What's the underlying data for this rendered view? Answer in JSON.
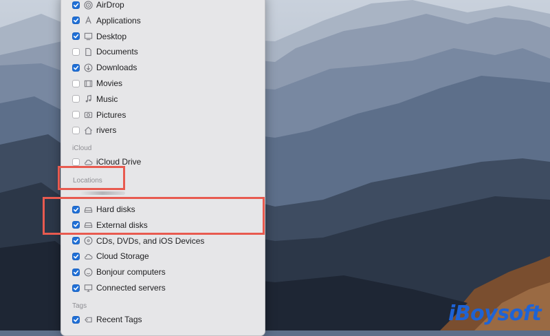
{
  "sidebar": {
    "favorites": [
      {
        "label": "AirDrop",
        "checked": true,
        "icon": "airdrop-icon"
      },
      {
        "label": "Applications",
        "checked": true,
        "icon": "applications-icon"
      },
      {
        "label": "Desktop",
        "checked": true,
        "icon": "desktop-icon"
      },
      {
        "label": "Documents",
        "checked": false,
        "icon": "document-icon"
      },
      {
        "label": "Downloads",
        "checked": true,
        "icon": "download-icon"
      },
      {
        "label": "Movies",
        "checked": false,
        "icon": "film-icon"
      },
      {
        "label": "Music",
        "checked": false,
        "icon": "music-note-icon"
      },
      {
        "label": "Pictures",
        "checked": false,
        "icon": "camera-icon"
      },
      {
        "label": "rivers",
        "checked": false,
        "icon": "home-icon"
      }
    ],
    "icloud_title": "iCloud",
    "icloud": [
      {
        "label": "iCloud Drive",
        "checked": false,
        "icon": "cloud-icon"
      }
    ],
    "locations_title": "Locations",
    "locations": [
      {
        "label": "Hard disks",
        "checked": true,
        "icon": "hard-disk-icon"
      },
      {
        "label": "External disks",
        "checked": true,
        "icon": "external-disk-icon"
      },
      {
        "label": "CDs, DVDs, and iOS Devices",
        "checked": true,
        "icon": "optical-disc-icon"
      },
      {
        "label": "Cloud Storage",
        "checked": true,
        "icon": "cloud-icon"
      },
      {
        "label": "Bonjour computers",
        "checked": true,
        "icon": "bonjour-icon"
      },
      {
        "label": "Connected servers",
        "checked": true,
        "icon": "server-icon"
      }
    ],
    "tags_title": "Tags",
    "tags": [
      {
        "label": "Recent Tags",
        "checked": true,
        "icon": "tag-icon"
      }
    ]
  },
  "watermark": "iBoysoft",
  "colors": {
    "accent": "#1f6fd6",
    "highlight": "#e85a4f",
    "watermark": "#1e63d6"
  }
}
